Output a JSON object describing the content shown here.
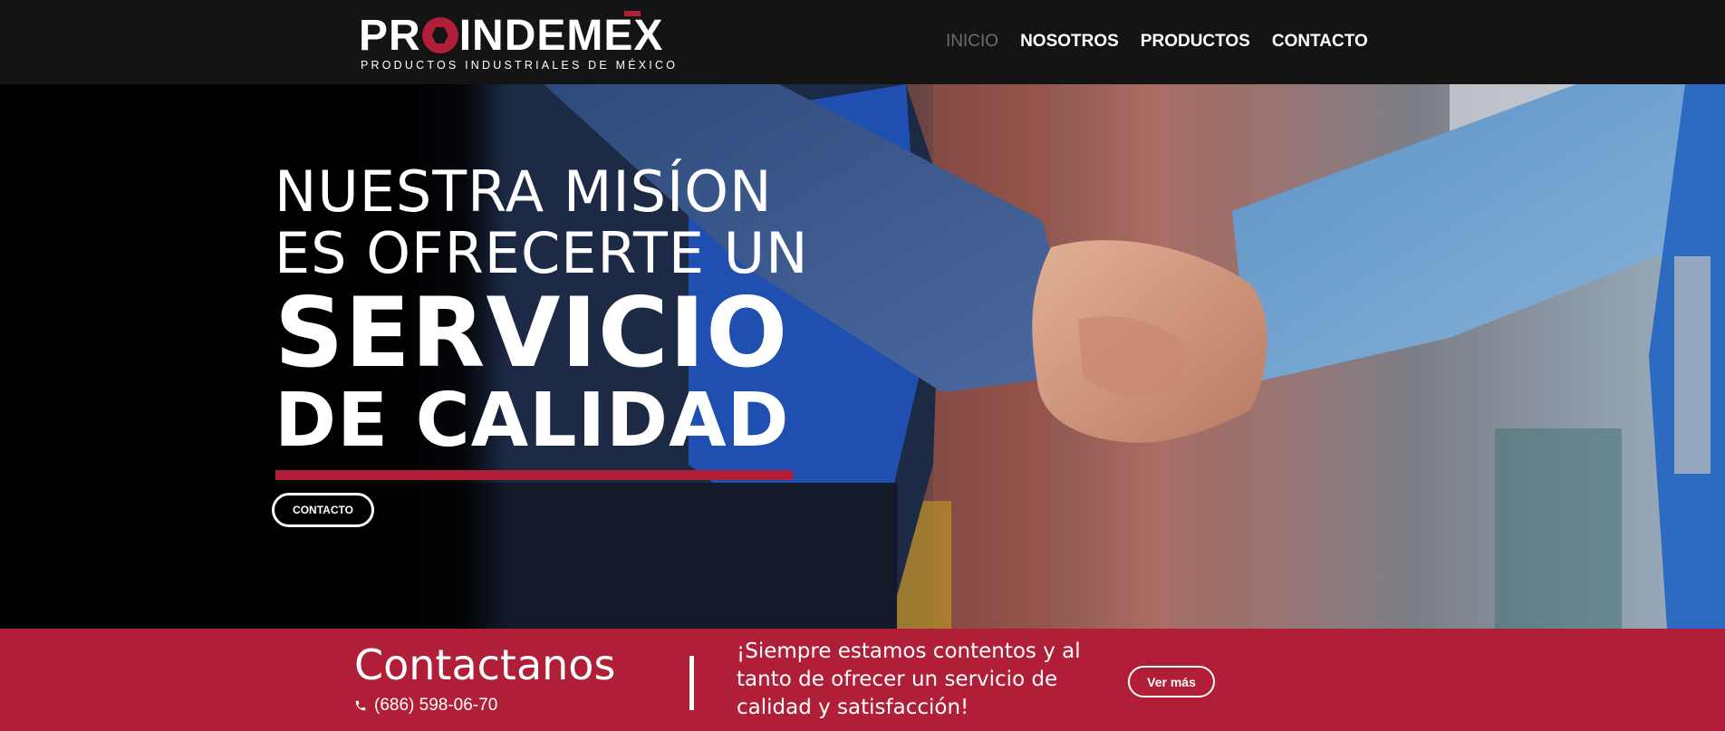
{
  "header": {
    "logo": {
      "main": "PROINDEMEX",
      "main_before_o": "PR",
      "main_after_o": "INDEMEX",
      "subtitle": "PRODUCTOS INDUSTRIALES DE MÉXICO"
    },
    "nav": [
      {
        "label": "INICIO",
        "active": true
      },
      {
        "label": "NOSOTROS",
        "active": false
      },
      {
        "label": "PRODUCTOS",
        "active": false
      },
      {
        "label": "CONTACTO",
        "active": false
      }
    ]
  },
  "hero": {
    "lines": [
      "NUESTRA MISÍON",
      "ES OFRECERTE UN",
      "SERVICIO",
      "DE CALIDAD"
    ],
    "button_label": "CONTACTO"
  },
  "contact_band": {
    "title": "Contactanos",
    "phone_icon": "phone-icon",
    "phone": "(686) 598-06-70",
    "message": "¡Siempre estamos contentos y al tanto de ofrecer un servicio de calidad y satisfacción!",
    "button_label": "Ver más"
  },
  "colors": {
    "brand_red": "#b01f37",
    "header_bg": "#141414",
    "nav_inactive": "#6d6d6d",
    "text": "#ffffff"
  }
}
